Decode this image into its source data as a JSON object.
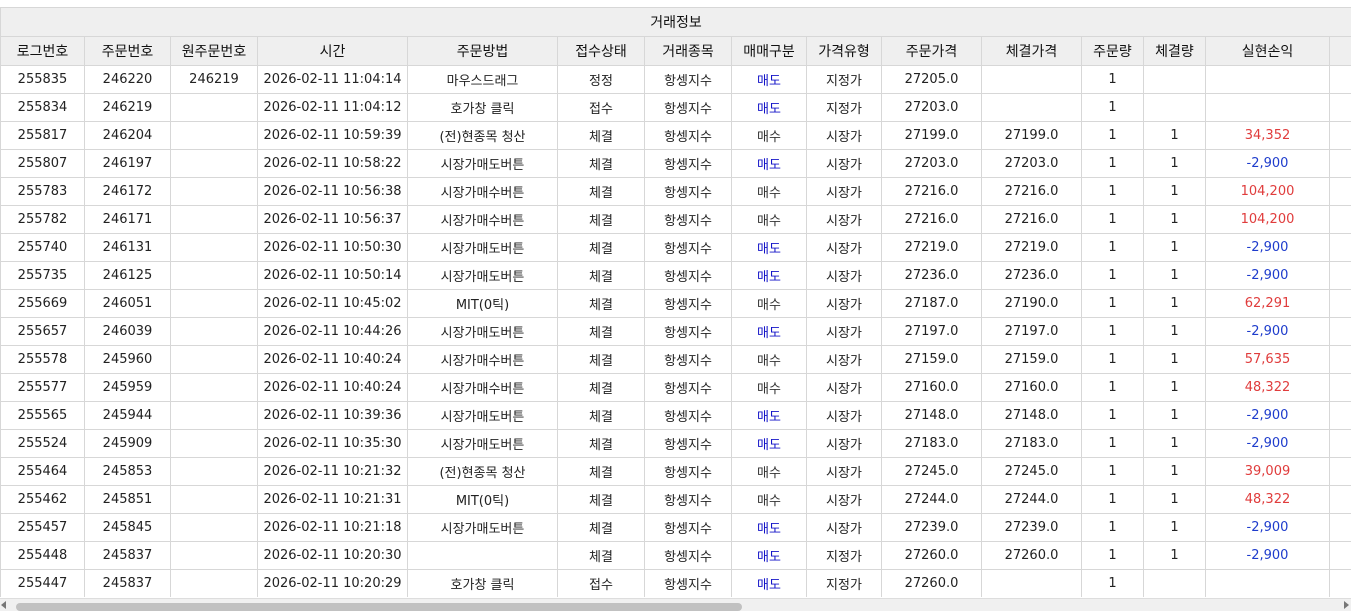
{
  "grid": {
    "group_header": "거래정보",
    "columns": [
      "로그번호",
      "주문번호",
      "원주문번호",
      "시간",
      "주문방법",
      "접수상태",
      "거래종목",
      "매매구분",
      "가격유형",
      "주문가격",
      "체결가격",
      "주문량",
      "체결량",
      "실현손익",
      ""
    ],
    "rows": [
      [
        "255835",
        "246220",
        "246219",
        "2026-02-11 11:04:14",
        "마우스드래그",
        "정정",
        "항셍지수",
        "매도",
        "지정가",
        "27205.0",
        "",
        "1",
        "",
        "",
        ""
      ],
      [
        "255834",
        "246219",
        "",
        "2026-02-11 11:04:12",
        "호가창 클릭",
        "접수",
        "항셍지수",
        "매도",
        "지정가",
        "27203.0",
        "",
        "1",
        "",
        "",
        ""
      ],
      [
        "255817",
        "246204",
        "",
        "2026-02-11 10:59:39",
        "(전)현종목 청산",
        "체결",
        "항셍지수",
        "매수",
        "시장가",
        "27199.0",
        "27199.0",
        "1",
        "1",
        "34,352",
        ""
      ],
      [
        "255807",
        "246197",
        "",
        "2026-02-11 10:58:22",
        "시장가매도버튼",
        "체결",
        "항셍지수",
        "매도",
        "시장가",
        "27203.0",
        "27203.0",
        "1",
        "1",
        "-2,900",
        ""
      ],
      [
        "255783",
        "246172",
        "",
        "2026-02-11 10:56:38",
        "시장가매수버튼",
        "체결",
        "항셍지수",
        "매수",
        "시장가",
        "27216.0",
        "27216.0",
        "1",
        "1",
        "104,200",
        ""
      ],
      [
        "255782",
        "246171",
        "",
        "2026-02-11 10:56:37",
        "시장가매수버튼",
        "체결",
        "항셍지수",
        "매수",
        "시장가",
        "27216.0",
        "27216.0",
        "1",
        "1",
        "104,200",
        ""
      ],
      [
        "255740",
        "246131",
        "",
        "2026-02-11 10:50:30",
        "시장가매도버튼",
        "체결",
        "항셍지수",
        "매도",
        "시장가",
        "27219.0",
        "27219.0",
        "1",
        "1",
        "-2,900",
        ""
      ],
      [
        "255735",
        "246125",
        "",
        "2026-02-11 10:50:14",
        "시장가매도버튼",
        "체결",
        "항셍지수",
        "매도",
        "시장가",
        "27236.0",
        "27236.0",
        "1",
        "1",
        "-2,900",
        ""
      ],
      [
        "255669",
        "246051",
        "",
        "2026-02-11 10:45:02",
        "MIT(0틱)",
        "체결",
        "항셍지수",
        "매수",
        "시장가",
        "27187.0",
        "27190.0",
        "1",
        "1",
        "62,291",
        ""
      ],
      [
        "255657",
        "246039",
        "",
        "2026-02-11 10:44:26",
        "시장가매도버튼",
        "체결",
        "항셍지수",
        "매도",
        "시장가",
        "27197.0",
        "27197.0",
        "1",
        "1",
        "-2,900",
        ""
      ],
      [
        "255578",
        "245960",
        "",
        "2026-02-11 10:40:24",
        "시장가매수버튼",
        "체결",
        "항셍지수",
        "매수",
        "시장가",
        "27159.0",
        "27159.0",
        "1",
        "1",
        "57,635",
        ""
      ],
      [
        "255577",
        "245959",
        "",
        "2026-02-11 10:40:24",
        "시장가매수버튼",
        "체결",
        "항셍지수",
        "매수",
        "시장가",
        "27160.0",
        "27160.0",
        "1",
        "1",
        "48,322",
        ""
      ],
      [
        "255565",
        "245944",
        "",
        "2026-02-11 10:39:36",
        "시장가매도버튼",
        "체결",
        "항셍지수",
        "매도",
        "시장가",
        "27148.0",
        "27148.0",
        "1",
        "1",
        "-2,900",
        ""
      ],
      [
        "255524",
        "245909",
        "",
        "2026-02-11 10:35:30",
        "시장가매도버튼",
        "체결",
        "항셍지수",
        "매도",
        "시장가",
        "27183.0",
        "27183.0",
        "1",
        "1",
        "-2,900",
        ""
      ],
      [
        "255464",
        "245853",
        "",
        "2026-02-11 10:21:32",
        "(전)현종목 청산",
        "체결",
        "항셍지수",
        "매수",
        "시장가",
        "27245.0",
        "27245.0",
        "1",
        "1",
        "39,009",
        ""
      ],
      [
        "255462",
        "245851",
        "",
        "2026-02-11 10:21:31",
        "MIT(0틱)",
        "체결",
        "항셍지수",
        "매수",
        "시장가",
        "27244.0",
        "27244.0",
        "1",
        "1",
        "48,322",
        ""
      ],
      [
        "255457",
        "245845",
        "",
        "2026-02-11 10:21:18",
        "시장가매도버튼",
        "체결",
        "항셍지수",
        "매도",
        "시장가",
        "27239.0",
        "27239.0",
        "1",
        "1",
        "-2,900",
        ""
      ],
      [
        "255448",
        "245837",
        "",
        "2026-02-11 10:20:30",
        "",
        "체결",
        "항셍지수",
        "매도",
        "지정가",
        "27260.0",
        "27260.0",
        "1",
        "1",
        "-2,900",
        ""
      ],
      [
        "255447",
        "245837",
        "",
        "2026-02-11 10:20:29",
        "호가창 클릭",
        "접수",
        "항셍지수",
        "매도",
        "지정가",
        "27260.0",
        "",
        "1",
        "",
        "",
        ""
      ]
    ]
  },
  "scrollbar": {
    "horizontal_position": 0
  },
  "colors": {
    "sell": "#1414c8",
    "buy": "#333333",
    "profit": "#e03c3c",
    "loss": "#1e3ccc",
    "header_bg": "#efefef",
    "grid_line": "#d7d7d7"
  }
}
